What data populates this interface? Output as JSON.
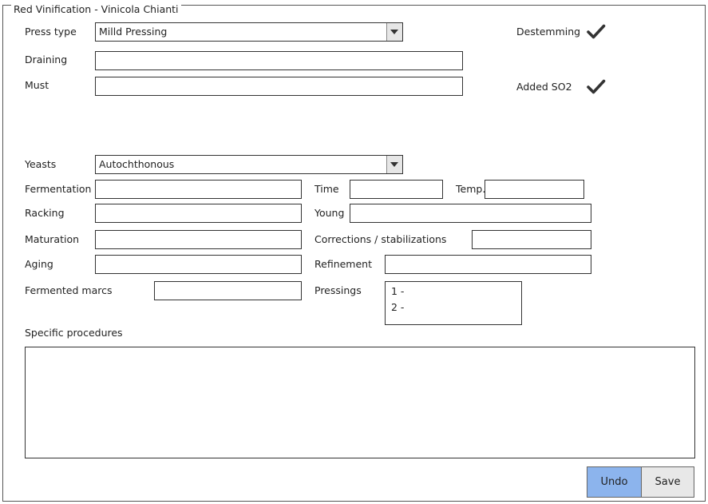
{
  "panel": {
    "title": "Red Vinification - Vinicola Chianti"
  },
  "fields": {
    "press_type": {
      "label": "Press type",
      "value": "Milld Pressing"
    },
    "draining": {
      "label": "Draining",
      "value": ""
    },
    "must": {
      "label": "Must",
      "value": ""
    },
    "yeasts": {
      "label": "Yeasts",
      "value": "Autochthonous"
    },
    "fermentation": {
      "label": "Fermentation",
      "value": ""
    },
    "time": {
      "label": "Time",
      "value": ""
    },
    "temp": {
      "label": "Temp.",
      "value": ""
    },
    "racking": {
      "label": "Racking",
      "value": ""
    },
    "young": {
      "label": "Young",
      "value": ""
    },
    "maturation": {
      "label": "Maturation",
      "value": ""
    },
    "corrections": {
      "label": "Corrections / stabilizations",
      "value": ""
    },
    "aging": {
      "label": "Aging",
      "value": ""
    },
    "refinement": {
      "label": "Refinement",
      "value": ""
    },
    "fermented_marcs": {
      "label": "Fermented marcs",
      "value": ""
    },
    "pressings": {
      "label": "Pressings",
      "items": [
        "1  -",
        "2  -"
      ]
    },
    "specific_procedures": {
      "label": "Specific procedures",
      "value": ""
    }
  },
  "checks": {
    "destemming": {
      "label": "Destemming",
      "checked": true,
      "icon": "checkmark-icon"
    },
    "added_so2": {
      "label": "Added SO2",
      "checked": true,
      "icon": "checkmark-icon"
    }
  },
  "buttons": {
    "undo": "Undo",
    "save": "Save"
  },
  "colors": {
    "undo_button": "#8cb4ed",
    "save_button": "#e8e8e8",
    "border": "#333333"
  }
}
